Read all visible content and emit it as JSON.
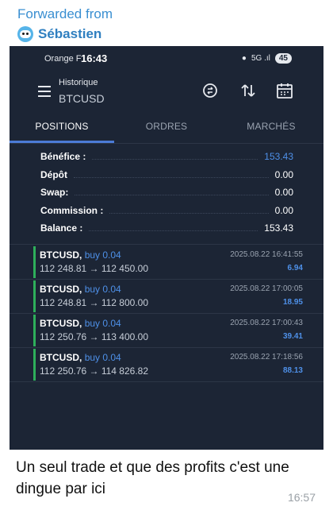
{
  "forward": {
    "label": "Forwarded from",
    "sender": "Sébastien"
  },
  "statusbar": {
    "carrier": "Orange F",
    "clock": "16:43",
    "signal": "5G .ıl",
    "battery": "45"
  },
  "app": {
    "subtitle": "Historique",
    "title": "BTCUSD"
  },
  "tabs": [
    {
      "label": "POSITIONS",
      "active": true
    },
    {
      "label": "ORDRES",
      "active": false
    },
    {
      "label": "MARCHÉS",
      "active": false
    }
  ],
  "summary": [
    {
      "label": "Bénéfice :",
      "value": "153.43",
      "highlight": true
    },
    {
      "label": "Dépôt",
      "value": "0.00",
      "highlight": false
    },
    {
      "label": "Swap:",
      "value": "0.00",
      "highlight": false
    },
    {
      "label": "Commission :",
      "value": "0.00",
      "highlight": false
    },
    {
      "label": "Balance :",
      "value": "153.43",
      "highlight": false
    }
  ],
  "deals": [
    {
      "symbol": "BTCUSD,",
      "side": "buy 0.04",
      "prices": "112 248.81 → 112 450.00",
      "time": "2025.08.22 16:41:55",
      "profit": "6.94"
    },
    {
      "symbol": "BTCUSD,",
      "side": "buy 0.04",
      "prices": "112 248.81 → 112 800.00",
      "time": "2025.08.22 17:00:05",
      "profit": "18.95"
    },
    {
      "symbol": "BTCUSD,",
      "side": "buy 0.04",
      "prices": "112 250.76 → 113 400.00",
      "time": "2025.08.22 17:00:43",
      "profit": "39.41"
    },
    {
      "symbol": "BTCUSD,",
      "side": "buy 0.04",
      "prices": "112 250.76 → 114 826.82",
      "time": "2025.08.22 17:18:56",
      "profit": "88.13"
    }
  ],
  "message": {
    "text": "Un seul trade et que des profits c'est une dingue par ici",
    "time": "16:57"
  },
  "colors": {
    "background": "#1c2535",
    "accent": "#4e90e8",
    "profit_bar": "#2eaf5b",
    "forward": "#3a8fd1"
  }
}
